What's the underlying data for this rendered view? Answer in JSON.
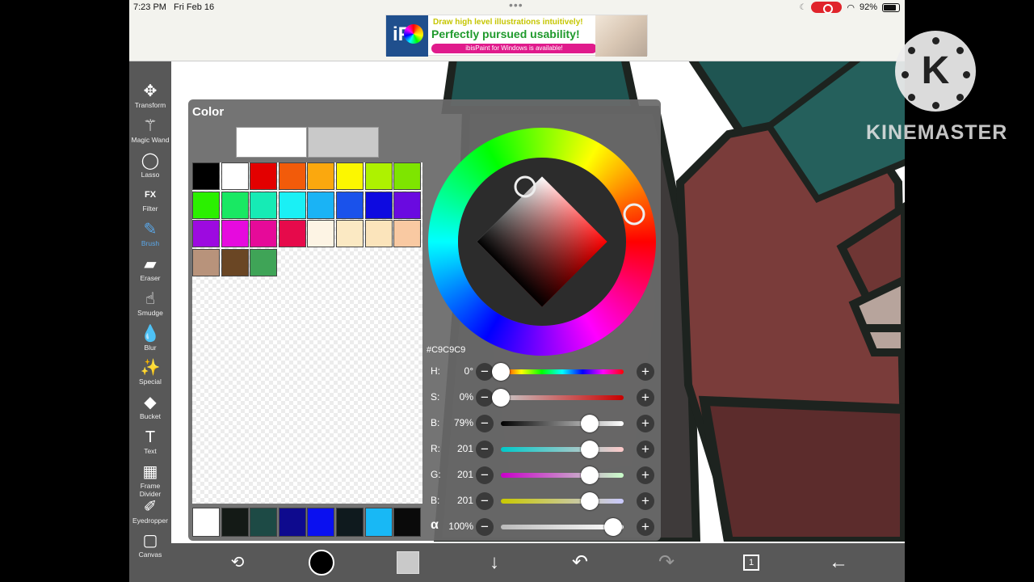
{
  "status_bar": {
    "time": "7:23 PM",
    "date": "Fri Feb 16",
    "battery": "92%"
  },
  "ad": {
    "logo_text": "iP",
    "line1": "Draw high level illustrations intuitively!",
    "line2": "Perfectly pursued usability!",
    "pill": "ibisPaint for Windows is available!"
  },
  "toolbar": {
    "tools": [
      {
        "label": "Transform",
        "icon": "transform-icon",
        "glyph": "✥"
      },
      {
        "label": "Magic Wand",
        "icon": "magic-wand-icon",
        "glyph": "⚚"
      },
      {
        "label": "Lasso",
        "icon": "lasso-icon",
        "glyph": "◯"
      },
      {
        "label": "Filter",
        "icon": "filter-icon",
        "glyph": "FX"
      },
      {
        "label": "Brush",
        "icon": "brush-icon",
        "glyph": "✎",
        "active": true
      },
      {
        "label": "Eraser",
        "icon": "eraser-icon",
        "glyph": "▰"
      },
      {
        "label": "Smudge",
        "icon": "smudge-icon",
        "glyph": "☝"
      },
      {
        "label": "Blur",
        "icon": "blur-icon",
        "glyph": "💧"
      },
      {
        "label": "Special",
        "icon": "special-icon",
        "glyph": "✨"
      },
      {
        "label": "Bucket",
        "icon": "bucket-icon",
        "glyph": "◆"
      },
      {
        "label": "Text",
        "icon": "text-icon",
        "glyph": "T"
      },
      {
        "label": "Frame Divider",
        "icon": "frame-divider-icon",
        "glyph": "▦"
      },
      {
        "label": "Eyedropper",
        "icon": "eyedropper-icon",
        "glyph": "✐"
      },
      {
        "label": "Canvas",
        "icon": "canvas-icon",
        "glyph": "▢"
      }
    ]
  },
  "color_panel": {
    "title": "Color",
    "main_color": "#FFFFFF",
    "sub_color": "#C9C9C9",
    "palette": [
      "#000000",
      "#FFFFFF",
      "#E30000",
      "#F25B0A",
      "#FBA80E",
      "#FCF700",
      "#AEF200",
      "#7EE500",
      "#2BF000",
      "#19E863",
      "#16EBB5",
      "#1AF0F5",
      "#1AB3F5",
      "#1A52EB",
      "#0E0AE0",
      "#6A0AE0",
      "#9D0AE0",
      "#E60ADE",
      "#E60A99",
      "#E60A4B",
      "#FDF4E4",
      "#FBE9C3",
      "#FBE4BB",
      "#F9C9A2",
      "#B8937B",
      "#6A4624",
      "#3FA457"
    ],
    "recent": [
      "#FFFFFF",
      "#141A16",
      "#1D4A45",
      "#0E0A8E",
      "#0A10F0",
      "#0F1A1E",
      "#18B8F5",
      "#0A0A0A"
    ],
    "hex": "#C9C9C9",
    "sliders": [
      {
        "label": "H:",
        "value": "0°",
        "level": 0,
        "gradient": "linear-gradient(90deg,#ff0000,#ffff00,#00ff00,#00ffff,#0000ff,#ff00ff,#ff0000)"
      },
      {
        "label": "S:",
        "value": "0%",
        "level": 0,
        "gradient": "linear-gradient(90deg,#c9c9c9,#c90000)"
      },
      {
        "label": "B:",
        "value": "79%",
        "level": 79,
        "gradient": "linear-gradient(90deg,#000000,#ffffff)"
      },
      {
        "label": "R:",
        "value": "201",
        "level": 78.8,
        "gradient": "linear-gradient(90deg,#00c9c9,#ffc9c9)"
      },
      {
        "label": "G:",
        "value": "201",
        "level": 78.8,
        "gradient": "linear-gradient(90deg,#c900c9,#c9ffc9)"
      },
      {
        "label": "B:",
        "value": "201",
        "level": 78.8,
        "gradient": "linear-gradient(90deg,#c9c900,#c9c9ff)"
      },
      {
        "label": "α",
        "value": "100%",
        "level": 100,
        "gradient": "linear-gradient(90deg,#bbbbbb,#ffffff)"
      }
    ]
  },
  "bottom_toolbar": {
    "layer_count": "1"
  },
  "watermark": {
    "logo_letter": "K",
    "text": "KINEMASTER"
  }
}
